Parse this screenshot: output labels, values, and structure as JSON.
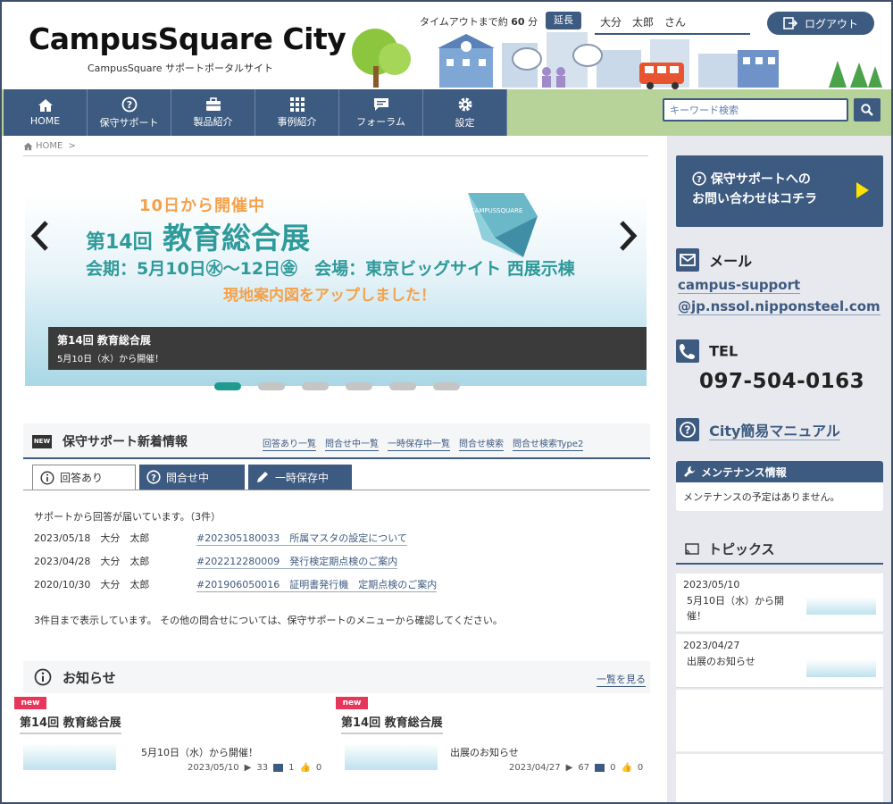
{
  "header": {
    "logo": "CampusSquare City",
    "subtitle": "CampusSquare サポートポータルサイト",
    "timeout_prefix": "タイムアウトまで約",
    "timeout_value": "60",
    "timeout_unit": "分",
    "extend_label": "延長",
    "user_name": "大分　太郎　さん",
    "logout_label": "ログアウト"
  },
  "nav": {
    "items": [
      {
        "label": "HOME",
        "icon": "home-icon"
      },
      {
        "label": "保守サポート",
        "icon": "help-icon"
      },
      {
        "label": "製品紹介",
        "icon": "briefcase-icon"
      },
      {
        "label": "事例紹介",
        "icon": "grid-icon"
      },
      {
        "label": "フォーラム",
        "icon": "chat-icon"
      },
      {
        "label": "設定",
        "icon": "gear-icon"
      }
    ],
    "search_placeholder": "キーワード検索"
  },
  "breadcrumb": {
    "home": "HOME"
  },
  "banner": {
    "tag": "10日から開催中",
    "title_prefix": "第14回",
    "title_main": "教育総合展",
    "dates": "会期：5月10日㊌～12日㊎　会場：東京ビッグサイト 西展示棟",
    "note": "現地案内図をアップしました！",
    "cube_text": "CAMPUSSQUARE",
    "caption_title": "第14回 教育総合展",
    "caption_sub": "5月10日（水）から開催！",
    "slide_count": 6,
    "active_slide": 1
  },
  "support_news": {
    "badge": "NEW",
    "title": "保守サポート新着情報",
    "links": [
      "回答あり一覧",
      "問合せ中一覧",
      "一時保存中一覧",
      "問合せ検索",
      "問合せ検索Type2"
    ],
    "tabs": [
      "回答あり",
      "問合せ中",
      "一時保存中"
    ],
    "info": "サポートから回答が届いています。（3件）",
    "rows": [
      {
        "date": "2023/05/18　大分　太郎",
        "link": "#202305180033　所属マスタの設定について"
      },
      {
        "date": "2023/04/28　大分　太郎",
        "link": "#202212280009　発行検定期点検のご案内"
      },
      {
        "date": "2020/10/30　大分　太郎",
        "link": "#201906050016　証明書発行機　定期点検のご案内"
      }
    ],
    "footer": "3件目まで表示しています。 その他の問合せについては、保守サポートのメニューから確認してください。"
  },
  "notices": {
    "title": "お知らせ",
    "more": "一覧を見る",
    "cards": [
      {
        "badge": "new",
        "title": "第14回 教育総合展",
        "text": "5月10日（水）から開催！",
        "date": "2023/05/10",
        "views": "33",
        "comments": "1",
        "likes": "0"
      },
      {
        "badge": "new",
        "title": "第14回 教育総合展",
        "text": "出展のお知らせ",
        "date": "2023/04/27",
        "views": "67",
        "comments": "0",
        "likes": "0"
      }
    ]
  },
  "sidebar": {
    "contact_line1": "保守サポートへの",
    "contact_line2": "お問い合わせはコチラ",
    "mail_label": "メール",
    "mail_line1": "campus-support",
    "mail_line2": "@jp.nssol.nipponsteel.com",
    "tel_label": "TEL",
    "tel_number": "097-504-0163",
    "manual_label": "City簡易マニュアル",
    "maint_title": "メンテナンス情報",
    "maint_text": "メンテナンスの予定はありません。",
    "topics_title": "トピックス",
    "topics": [
      {
        "date": "2023/05/10",
        "text": "5月10日（水）から開催！"
      },
      {
        "date": "2023/04/27",
        "text": "出展のお知らせ"
      }
    ]
  },
  "colors": {
    "navy": "#3d5a80",
    "green": "#b7d39a",
    "teal": "#1e9a8f",
    "orange": "#f5a14a",
    "pink": "#e8355a"
  }
}
